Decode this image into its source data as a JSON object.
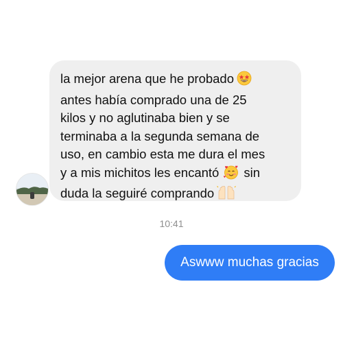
{
  "conversation": {
    "incoming_message": {
      "lines": [
        "la mejor arena que he probado",
        "antes había comprado una de 25",
        "kilos y no aglutinaba bien y se",
        "terminaba a la segunda semana de",
        "uso, en cambio esta me dura el mes",
        "y a mis michitos les encantó",
        "sin",
        "duda la seguiré comprando"
      ],
      "emojis": [
        "star-struck-emoji",
        "smiling-face-with-hearts-emoji",
        "raising-hands-emoji"
      ]
    },
    "timestamp": "10:41",
    "outgoing_message": {
      "text": "Aswww muchas gracias"
    }
  },
  "colors": {
    "incoming_bubble": "#efefef",
    "outgoing_bubble": "#2f7df6",
    "timestamp_text": "#8e8e8e"
  }
}
